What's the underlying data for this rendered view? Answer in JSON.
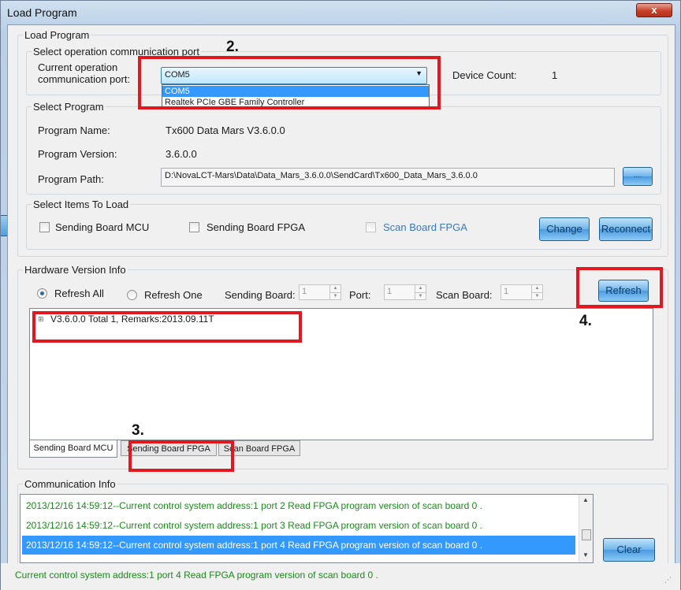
{
  "window": {
    "title": "Load Program",
    "close_label": "x"
  },
  "load_program": {
    "group_label": "Load Program",
    "select_port": {
      "group_label": "Select operation communication port",
      "current_port_label": "Current operation communication port:",
      "current_port_value": "COM5",
      "dropdown_options": [
        "COM5",
        "Realtek PCIe GBE Family Controller"
      ],
      "device_count_label": "Device Count:",
      "device_count_value": "1"
    },
    "select_program": {
      "group_label": "Select Program",
      "name_label": "Program Name:",
      "name_value": "Tx600  Data  Mars  V3.6.0.0",
      "version_label": "Program Version:",
      "version_value": "3.6.0.0",
      "path_label": "Program Path:",
      "path_value": "D:\\NovaLCT-Mars\\Data\\Data_Mars_3.6.0.0\\SendCard\\Tx600_Data_Mars_3.6.0.0",
      "browse_label": "...."
    },
    "select_items": {
      "group_label": "Select Items To Load",
      "sending_mcu": "Sending Board MCU",
      "sending_fpga": "Sending Board FPGA",
      "scan_fpga": "Scan Board FPGA",
      "change_label": "Change",
      "reconnect_label": "Reconnect"
    }
  },
  "hardware": {
    "group_label": "Hardware Version Info",
    "refresh_all": "Refresh All",
    "refresh_one": "Refresh One",
    "sending_board_label": "Sending Board:",
    "sending_board_value": "1",
    "port_label": "Port:",
    "port_value": "1",
    "scan_board_label": "Scan Board:",
    "scan_board_value": "1",
    "refresh_label": "Refresh",
    "tree_item": "V3.6.0.0 Total 1, Remarks:2013.09.11T",
    "tabs": [
      "Sending Board MCU",
      "Sending Board FPGA",
      "Scan Board FPGA"
    ]
  },
  "communication": {
    "group_label": "Communication Info",
    "lines": [
      "2013/12/16 14:59:12--Current control system address:1 port 2 Read FPGA program version of scan board 0 .",
      "2013/12/16 14:59:12--Current control system address:1 port 3 Read FPGA program version of scan board 0 .",
      "2013/12/16 14:59:12--Current control system address:1 port 4 Read FPGA program version of scan board 0 ."
    ],
    "clear_label": "Clear"
  },
  "status": "Current control system address:1 port 4 Read FPGA program version of scan board 0 .",
  "annotations": {
    "step2": "2.",
    "step3": "3.",
    "step4": "4."
  },
  "colors": {
    "log_text": "#1c8a1c",
    "selection": "#3399ff",
    "annotation_red": "#e0191f",
    "button_blue": "#6fb4ea"
  }
}
